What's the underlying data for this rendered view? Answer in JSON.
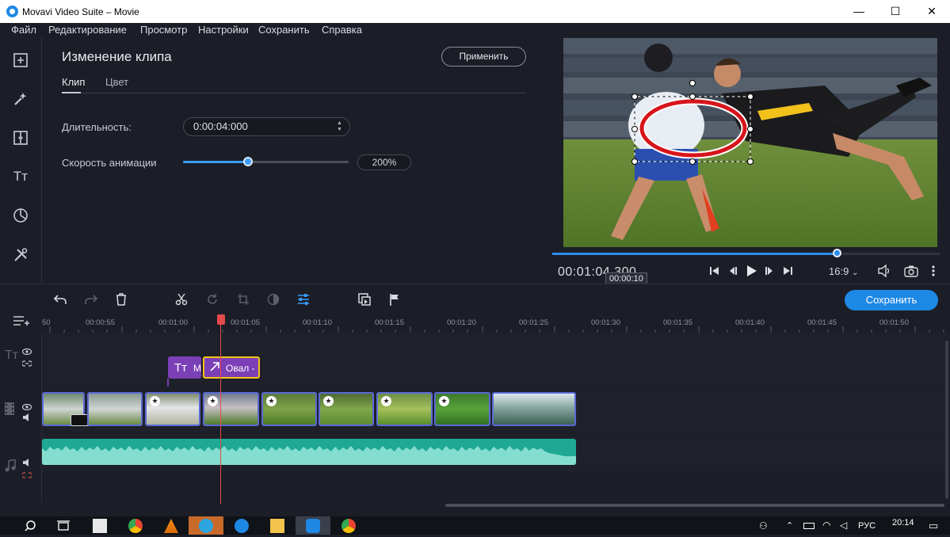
{
  "window": {
    "title": "Movavi Video Suite – Movie",
    "minimize": "—",
    "maximize": "☐",
    "close": "✕"
  },
  "menu": [
    "Файл",
    "Редактирование",
    "Просмотр",
    "Настройки",
    "Сохранить",
    "Справка"
  ],
  "sidebar": [
    {
      "name": "import-icon"
    },
    {
      "name": "filters-icon"
    },
    {
      "name": "transitions-icon"
    },
    {
      "name": "titles-icon",
      "glyph": "Tт"
    },
    {
      "name": "stickers-icon"
    },
    {
      "name": "more-tools-icon"
    }
  ],
  "panel": {
    "title": "Изменение клипа",
    "apply_label": "Применить",
    "tabs": [
      {
        "label": "Клип"
      },
      {
        "label": "Цвет"
      }
    ],
    "duration_label": "Длительность:",
    "duration_value": "0:00:04:000",
    "speed_label": "Скорость анимации",
    "speed_fraction": 0.39,
    "speed_value": "200%"
  },
  "player": {
    "timecode": "00:01:04.300",
    "tooltip": "00:00:10",
    "aspect_ratio": "16:9",
    "progress_fraction": 0.74
  },
  "toolbar": {
    "save_label": "Сохранить"
  },
  "ruler": [
    "50",
    "00:00:55",
    "00:01:00",
    "00:01:05",
    "00:01:10",
    "00:01:15",
    "00:01:20",
    "00:01:25",
    "00:01:30",
    "00:01:35",
    "00:01:40",
    "00:01:45",
    "00:01:50"
  ],
  "title_clips": [
    {
      "label": "М"
    },
    {
      "label": "Овал -"
    }
  ],
  "titles_glyph": "Tт",
  "taskbar": {
    "time": "20:14",
    "lang": "РУС"
  }
}
